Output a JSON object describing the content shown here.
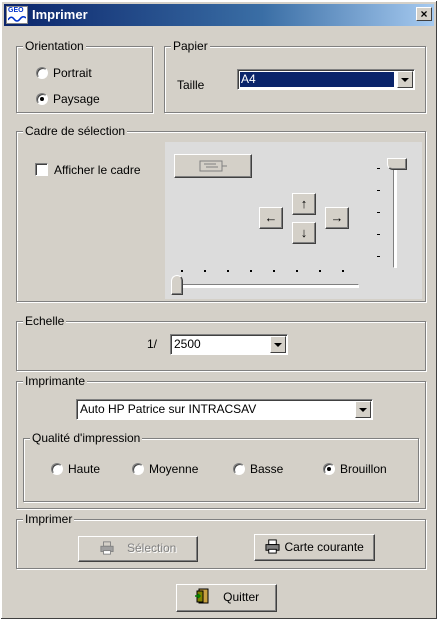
{
  "window": {
    "title": "Imprimer",
    "close_glyph": "×",
    "app_icon_text": "GEO"
  },
  "orientation": {
    "legend": "Orientation",
    "options": [
      {
        "label": "Portrait",
        "selected": false
      },
      {
        "label": "Paysage",
        "selected": true
      }
    ]
  },
  "papier": {
    "legend": "Papier",
    "taille_label": "Taille",
    "taille_value": "A4"
  },
  "cadre": {
    "legend": "Cadre de sélection",
    "afficher_label": "Afficher le cadre",
    "afficher_checked": false,
    "arrows": {
      "up": "↑",
      "down": "↓",
      "left": "←",
      "right": "→"
    },
    "horizontal_slider_value": 0,
    "vertical_slider_value": 1
  },
  "echelle": {
    "legend": "Echelle",
    "prefix": "1/",
    "value": "2500"
  },
  "imprimante": {
    "legend": "Imprimante",
    "printer": "Auto HP Patrice sur INTRACSAV",
    "qualite": {
      "legend": "Qualité d'impression",
      "options": [
        {
          "label": "Haute",
          "selected": false
        },
        {
          "label": "Moyenne",
          "selected": false
        },
        {
          "label": "Basse",
          "selected": false
        },
        {
          "label": "Brouillon",
          "selected": true
        }
      ]
    }
  },
  "imprimer": {
    "legend": "Imprimer",
    "selection_label": "Sélection",
    "carte_label": "Carte courante"
  },
  "quitter_label": "Quitter"
}
